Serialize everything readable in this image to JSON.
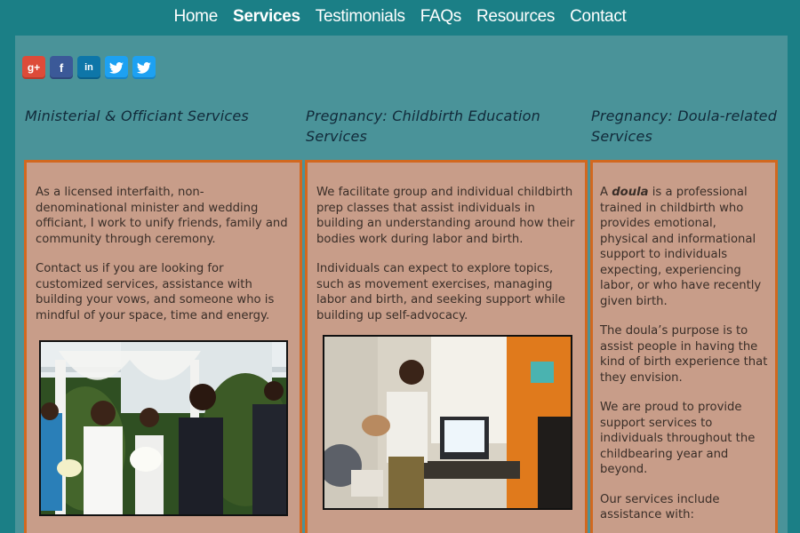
{
  "nav": {
    "items": [
      "Home",
      "Services",
      "Testimonials",
      "FAQs",
      "Resources",
      "Contact"
    ],
    "active": "Services"
  },
  "social": [
    {
      "icon": "google-plus-icon",
      "glyph": "g+"
    },
    {
      "icon": "facebook-icon",
      "glyph": "f"
    },
    {
      "icon": "linkedin-icon",
      "glyph": "in"
    },
    {
      "icon": "twitter-icon",
      "glyph": "🐦"
    },
    {
      "icon": "twitter-icon",
      "glyph": "🐦"
    }
  ],
  "columns": [
    {
      "title": "Ministerial & Officiant Services",
      "paragraphs": [
        "As a licensed interfaith, non-denominational minister and wedding officiant, I work to unify friends, family and community through ceremony.",
        "Contact us if you are looking for customized services, assistance with building your vows, and someone who is mindful of your space, time and energy."
      ]
    },
    {
      "title": "Pregnancy: Childbirth Education Services",
      "paragraphs": [
        "We facilitate group and individual childbirth prep classes that assist individuals in building an understanding around how their bodies work during labor and birth.",
        "Individuals can expect to explore topics, such as movement exercises, managing labor and birth, and seeking support while building up self-advocacy."
      ]
    },
    {
      "title": "Pregnancy: Doula-related Services",
      "lead_pre": "A ",
      "lead_term": "doula",
      "lead_post": " is a professional trained in childbirth who provides emotional, physical and informational support to individuals expecting, experiencing labor, or who have recently given birth.",
      "paragraphs": [
        "The doula’s purpose is to assist people in having the kind of birth experience that they envision.",
        "We are proud to provide support services to individuals throughout the childbearing year and beyond.",
        "Our services include assistance with:"
      ]
    }
  ],
  "colors": {
    "background": "#1b7f86",
    "panel": "#4a9399",
    "box": "#c89d89",
    "box_border": "#d2681f"
  }
}
